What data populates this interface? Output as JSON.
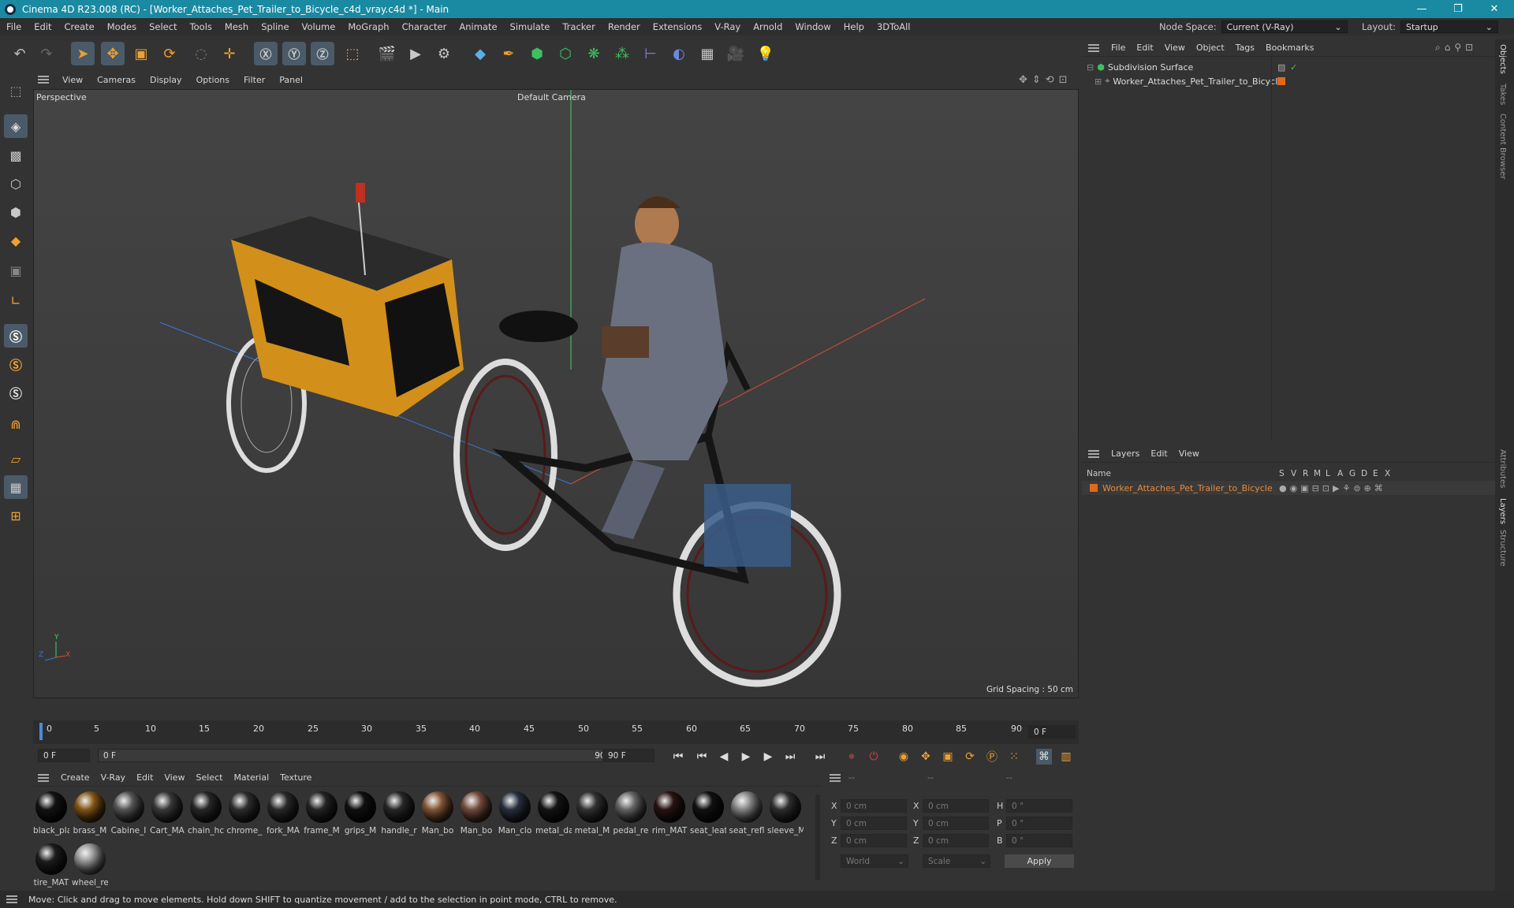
{
  "window": {
    "title": "Cinema 4D R23.008 (RC) - [Worker_Attaches_Pet_Trailer_to_Bicycle_c4d_vray.c4d *] - Main",
    "controls": [
      "—",
      "❐",
      "✕"
    ]
  },
  "menubar": {
    "items": [
      "File",
      "Edit",
      "Create",
      "Modes",
      "Select",
      "Tools",
      "Mesh",
      "Spline",
      "Volume",
      "MoGraph",
      "Character",
      "Animate",
      "Simulate",
      "Tracker",
      "Render",
      "Extensions",
      "V-Ray",
      "Arnold",
      "Window",
      "Help",
      "3DToAll"
    ],
    "node_space_label": "Node Space:",
    "node_space_value": "Current (V-Ray)",
    "layout_label": "Layout:",
    "layout_value": "Startup"
  },
  "viewport": {
    "menu": [
      "View",
      "Cameras",
      "Display",
      "Options",
      "Filter",
      "Panel"
    ],
    "projection": "Perspective",
    "camera": "Default Camera",
    "grid_spacing": "Grid Spacing : 50 cm",
    "axis_x": "X",
    "axis_y": "Y",
    "axis_z": "Z"
  },
  "timeline": {
    "ticks": [
      "0",
      "5",
      "10",
      "15",
      "20",
      "25",
      "30",
      "35",
      "40",
      "45",
      "50",
      "55",
      "60",
      "65",
      "70",
      "75",
      "80",
      "85",
      "90"
    ],
    "current_frame": "0 F",
    "start_frame": "0 F",
    "range_start": "0 F",
    "range_end": "90 F",
    "end_frame": "90 F"
  },
  "materials": {
    "menu": [
      "Create",
      "V-Ray",
      "Edit",
      "View",
      "Select",
      "Material",
      "Texture"
    ],
    "items": [
      {
        "name": "black_pla",
        "color": "#141414"
      },
      {
        "name": "brass_M",
        "color": "#8a5a18"
      },
      {
        "name": "Cabine_I",
        "color": "#5a5a5a"
      },
      {
        "name": "Cart_MA",
        "color": "#3c3c3c"
      },
      {
        "name": "chain_hc",
        "color": "#2a2a2a"
      },
      {
        "name": "chrome_",
        "color": "#303030"
      },
      {
        "name": "fork_MA",
        "color": "#2c2c2c"
      },
      {
        "name": "frame_M",
        "color": "#262626"
      },
      {
        "name": "grips_M",
        "color": "#111111"
      },
      {
        "name": "handle_r",
        "color": "#2a2a2a"
      },
      {
        "name": "Man_bo",
        "color": "#8a5a3a"
      },
      {
        "name": "Man_bo",
        "color": "#7a5040"
      },
      {
        "name": "Man_clo",
        "color": "#2a3240"
      },
      {
        "name": "metal_da",
        "color": "#151515"
      },
      {
        "name": "metal_M",
        "color": "#353535"
      },
      {
        "name": "pedal_re",
        "color": "#6a6a6a"
      },
      {
        "name": "rim_MAT",
        "color": "#2a1414"
      },
      {
        "name": "seat_leat",
        "color": "#121212"
      },
      {
        "name": "seat_refl",
        "color": "#8a8a8a"
      },
      {
        "name": "sleeve_M",
        "color": "#303030"
      },
      {
        "name": "tire_MAT",
        "color": "#1e1e1e"
      },
      {
        "name": "wheel_re",
        "color": "#9a9a9a"
      }
    ]
  },
  "coords": {
    "headers": [
      "--",
      "--",
      "--"
    ],
    "rows": [
      {
        "l1": "X",
        "v1": "0 cm",
        "l2": "X",
        "v2": "0 cm",
        "l3": "H",
        "v3": "0 °"
      },
      {
        "l1": "Y",
        "v1": "0 cm",
        "l2": "Y",
        "v2": "0 cm",
        "l3": "P",
        "v3": "0 °"
      },
      {
        "l1": "Z",
        "v1": "0 cm",
        "l2": "Z",
        "v2": "0 cm",
        "l3": "B",
        "v3": "0 °"
      }
    ],
    "space": "World",
    "mode": "Scale",
    "apply": "Apply"
  },
  "objects": {
    "menu": [
      "File",
      "Edit",
      "View",
      "Object",
      "Tags",
      "Bookmarks"
    ],
    "items": [
      {
        "name": "Subdivision Surface"
      },
      {
        "name": "Worker_Attaches_Pet_Trailer_to_Bicycle"
      }
    ]
  },
  "layers": {
    "menu": [
      "Layers",
      "Edit",
      "View"
    ],
    "col_name": "Name",
    "cols": [
      "S",
      "V",
      "R",
      "M",
      "L",
      "A",
      "G",
      "D",
      "E",
      "X"
    ],
    "items": [
      {
        "name": "Worker_Attaches_Pet_Trailer_to_Bicycle",
        "color": "#e06a1a"
      }
    ]
  },
  "sidetabs": [
    "Objects",
    "Takes",
    "Content Browser",
    "Attributes",
    "Layers",
    "Structure"
  ],
  "status": "Move: Click and drag to move elements. Hold down SHIFT to quantize movement / add to the selection in point mode, CTRL to remove."
}
